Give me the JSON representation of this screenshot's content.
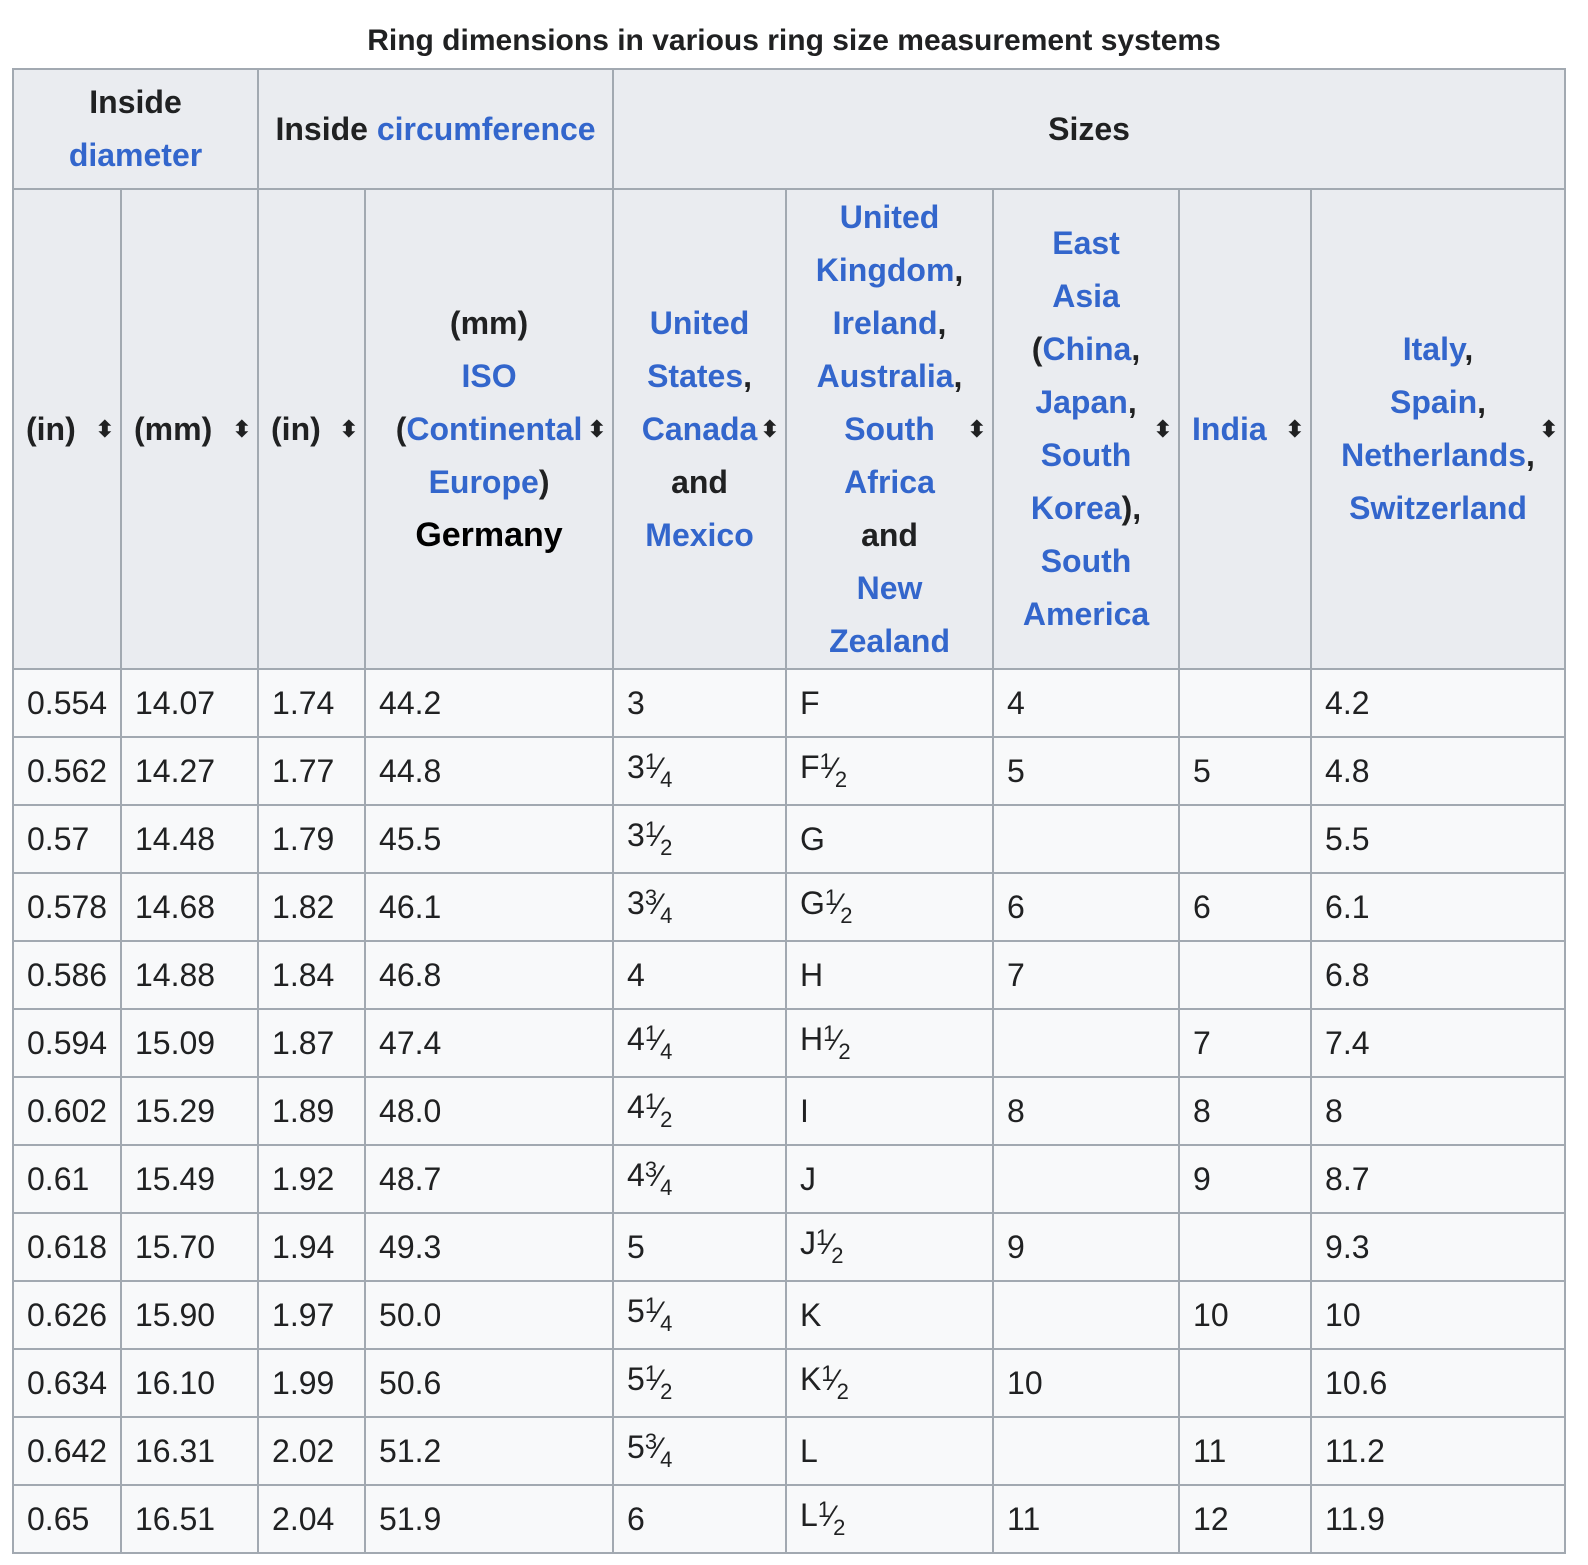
{
  "caption": "Ring dimensions in various ring size measurement systems",
  "header_groups": {
    "inside_label": "Inside",
    "diameter_link": "diameter",
    "circumference_label": "Inside",
    "circumference_link": "circumference",
    "sizes_label": "Sizes"
  },
  "columns": {
    "d_in": "(in)",
    "d_mm": "(mm)",
    "c_in": "(in)",
    "iso_mm": "(mm)",
    "iso_link": "ISO",
    "iso_open": "(",
    "iso_continental": "Continental",
    "iso_europe": "Europe",
    "iso_close": ")",
    "iso_germany": "Germany",
    "us_1": "United",
    "us_2": "States",
    "us_3": "Canada",
    "us_and": "and",
    "us_4": "Mexico",
    "uk_1": "United",
    "uk_2": "Kingdom",
    "uk_3": "Ireland",
    "uk_4": "Australia",
    "uk_5": "South",
    "uk_6": "Africa",
    "uk_and": "and",
    "uk_7": "New",
    "uk_8": "Zealand",
    "ea_1": "East",
    "ea_2": "Asia",
    "ea_3": "China",
    "ea_4": "Japan",
    "ea_5": "South",
    "ea_6": "Korea",
    "ea_7": "South",
    "ea_8": "America",
    "india": "India",
    "it_1": "Italy",
    "it_2": "Spain",
    "it_3": "Netherlands",
    "it_4": "Switzerland",
    "sort_icon": "sort-icon"
  },
  "rows": [
    {
      "d_in": "0.554",
      "d_mm": "14.07",
      "c_in": "1.74",
      "iso": "44.2",
      "us_w": "3",
      "us_n": "",
      "us_d": "",
      "uk_l": "F",
      "uk_half": false,
      "ea": "4",
      "india": "",
      "it": "4.2"
    },
    {
      "d_in": "0.562",
      "d_mm": "14.27",
      "c_in": "1.77",
      "iso": "44.8",
      "us_w": "3",
      "us_n": "1",
      "us_d": "4",
      "uk_l": "F",
      "uk_half": true,
      "ea": "5",
      "india": "5",
      "it": "4.8"
    },
    {
      "d_in": "0.57",
      "d_mm": "14.48",
      "c_in": "1.79",
      "iso": "45.5",
      "us_w": "3",
      "us_n": "1",
      "us_d": "2",
      "uk_l": "G",
      "uk_half": false,
      "ea": "",
      "india": "",
      "it": "5.5"
    },
    {
      "d_in": "0.578",
      "d_mm": "14.68",
      "c_in": "1.82",
      "iso": "46.1",
      "us_w": "3",
      "us_n": "3",
      "us_d": "4",
      "uk_l": "G",
      "uk_half": true,
      "ea": "6",
      "india": "6",
      "it": "6.1"
    },
    {
      "d_in": "0.586",
      "d_mm": "14.88",
      "c_in": "1.84",
      "iso": "46.8",
      "us_w": "4",
      "us_n": "",
      "us_d": "",
      "uk_l": "H",
      "uk_half": false,
      "ea": "7",
      "india": "",
      "it": "6.8"
    },
    {
      "d_in": "0.594",
      "d_mm": "15.09",
      "c_in": "1.87",
      "iso": "47.4",
      "us_w": "4",
      "us_n": "1",
      "us_d": "4",
      "uk_l": "H",
      "uk_half": true,
      "ea": "",
      "india": "7",
      "it": "7.4"
    },
    {
      "d_in": "0.602",
      "d_mm": "15.29",
      "c_in": "1.89",
      "iso": "48.0",
      "us_w": "4",
      "us_n": "1",
      "us_d": "2",
      "uk_l": "I",
      "uk_half": false,
      "ea": "8",
      "india": "8",
      "it": "8"
    },
    {
      "d_in": "0.61",
      "d_mm": "15.49",
      "c_in": "1.92",
      "iso": "48.7",
      "us_w": "4",
      "us_n": "3",
      "us_d": "4",
      "uk_l": "J",
      "uk_half": false,
      "ea": "",
      "india": "9",
      "it": "8.7"
    },
    {
      "d_in": "0.618",
      "d_mm": "15.70",
      "c_in": "1.94",
      "iso": "49.3",
      "us_w": "5",
      "us_n": "",
      "us_d": "",
      "uk_l": "J",
      "uk_half": true,
      "ea": "9",
      "india": "",
      "it": "9.3"
    },
    {
      "d_in": "0.626",
      "d_mm": "15.90",
      "c_in": "1.97",
      "iso": "50.0",
      "us_w": "5",
      "us_n": "1",
      "us_d": "4",
      "uk_l": "K",
      "uk_half": false,
      "ea": "",
      "india": "10",
      "it": "10"
    },
    {
      "d_in": "0.634",
      "d_mm": "16.10",
      "c_in": "1.99",
      "iso": "50.6",
      "us_w": "5",
      "us_n": "1",
      "us_d": "2",
      "uk_l": "K",
      "uk_half": true,
      "ea": "10",
      "india": "",
      "it": "10.6"
    },
    {
      "d_in": "0.642",
      "d_mm": "16.31",
      "c_in": "2.02",
      "iso": "51.2",
      "us_w": "5",
      "us_n": "3",
      "us_d": "4",
      "uk_l": "L",
      "uk_half": false,
      "ea": "",
      "india": "11",
      "it": "11.2"
    },
    {
      "d_in": "0.65",
      "d_mm": "16.51",
      "c_in": "2.04",
      "iso": "51.9",
      "us_w": "6",
      "us_n": "",
      "us_d": "",
      "uk_l": "L",
      "uk_half": true,
      "ea": "11",
      "india": "12",
      "it": "11.9"
    }
  ],
  "colors": {
    "link": "#3366cc",
    "header_bg": "#eaecf0",
    "cell_bg": "#f8f9fa",
    "border": "#a2a9b1"
  }
}
